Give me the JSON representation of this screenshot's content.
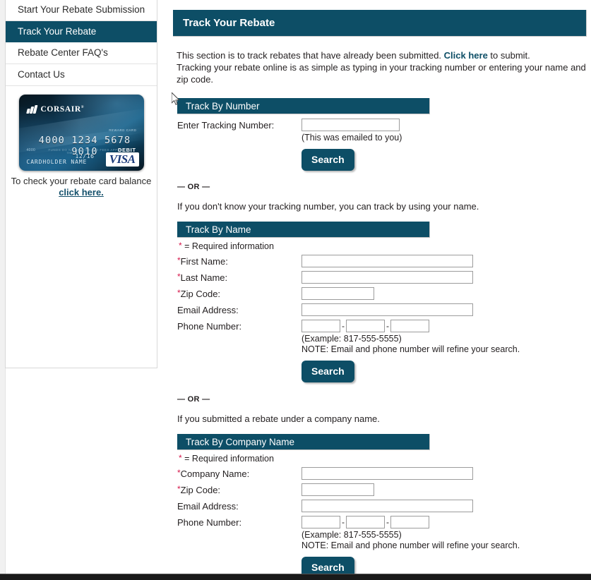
{
  "colors": {
    "brand_teal": "#0d4e66",
    "required_star": "#d5174a",
    "link": "#14506b"
  },
  "sidebar": {
    "nav": [
      {
        "label": "Start Your Rebate Submission",
        "active": false
      },
      {
        "label": "Track Your Rebate",
        "active": true
      },
      {
        "label": "Rebate Center FAQ's",
        "active": false
      },
      {
        "label": "Contact Us",
        "active": false
      }
    ],
    "card": {
      "brand": "CORSAIR",
      "brand_mark": "®",
      "reward_label": "REWARD CARD",
      "number": "4000 1234 5678 9010",
      "small_left": "4000",
      "fine_print": "FUNDS DO NOT EXPIRE. NO FEES APPLY",
      "debit": "DEBIT",
      "exp_label": "THRU",
      "expiry": "12/16",
      "cardholder": "CARDHOLDER NAME",
      "network": "VISA"
    },
    "card_caption": "To check your rebate card balance",
    "card_caption_link": "click here."
  },
  "header": {
    "title": "Track Your Rebate"
  },
  "intro": {
    "line1_before": "This section is to track rebates that have already been submitted. ",
    "line1_link": "Click here",
    "line1_after": " to submit.",
    "line2": "Tracking your rebate online is as simple as typing in your tracking number or entering your name and zip code."
  },
  "common": {
    "or_divider": "— OR —",
    "required_legend": "= Required information",
    "phone_example": "(Example: 817-555-5555)",
    "phone_note": "NOTE: Email and phone number will refine your search.",
    "search_label": "Search",
    "dash": "-"
  },
  "track_by_number": {
    "bar_title": "Track By Number",
    "label": "Enter Tracking Number:",
    "value": "",
    "placeholder": "",
    "hint": "(This was emailed to you)",
    "search_label": "Search"
  },
  "track_by_name": {
    "lead": "If you don't know your tracking number, you can track by using your name.",
    "bar_title": "Track By Name",
    "fields": [
      {
        "label": "First Name:",
        "required": true,
        "value": "",
        "size": "wide"
      },
      {
        "label": "Last Name:",
        "required": true,
        "value": "",
        "size": "wide"
      },
      {
        "label": "Zip Code:",
        "required": true,
        "value": "",
        "size": "zip"
      },
      {
        "label": "Email Address:",
        "required": false,
        "value": "",
        "size": "wide"
      }
    ],
    "phone_label": "Phone Number:",
    "phone_parts": [
      "",
      "",
      ""
    ],
    "search_label": "Search"
  },
  "track_by_company": {
    "lead": "If you submitted a rebate under a company name.",
    "bar_title": "Track By Company Name",
    "fields": [
      {
        "label": "Company Name:",
        "required": true,
        "value": "",
        "size": "wide"
      },
      {
        "label": "Zip Code:",
        "required": true,
        "value": "",
        "size": "zip"
      },
      {
        "label": "Email Address:",
        "required": false,
        "value": "",
        "size": "wide"
      }
    ],
    "phone_label": "Phone Number:",
    "phone_parts": [
      "",
      "",
      ""
    ],
    "search_label": "Search"
  }
}
